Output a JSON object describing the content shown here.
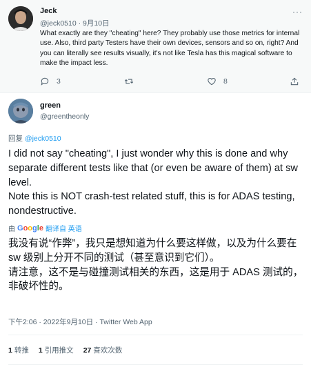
{
  "parent_tweet": {
    "author_name": "Jeck",
    "handle": "@jeck0510",
    "separator": "·",
    "date": "9月10日",
    "more": "···",
    "text": "What exactly are they \"cheating\" here? They probably use those metrics for internal use. Also, third party Testers have their own devices, sensors and so on, right? And you can literally see results visually, it's not like Tesla has this magical software to make the impact less.",
    "reply_count": "3",
    "retweet_count": "",
    "like_count": "8"
  },
  "main_tweet": {
    "author_name": "green",
    "handle": "@greentheonly",
    "reply_prefix": "回复",
    "reply_handle": "@jeck0510",
    "text_en": "I did not say \"cheating\", I just wonder why this is done and why separate different tests like that (or even be aware of them) at sw level.\nNote this is NOT crash-test related stuff, this is for ADAS testing, nondestructive.",
    "translate_prefix": "由",
    "translate_brand": "Google",
    "translate_label": "翻译自 英语",
    "text_zh": "我没有说“作弊”，我只是想知道为什么要这样做，以及为什么要在 sw 级别上分开不同的测试（甚至意识到它们）。\n请注意，这不是与碰撞测试相关的东西，这是用于 ADAS 测试的，非破坏性的。",
    "timestamp": "下午2:06 · 2022年9月10日 · Twitter Web App",
    "stats": {
      "retweets_num": "1",
      "retweets_label": "转推",
      "quotes_num": "1",
      "quotes_label": "引用推文",
      "likes_num": "27",
      "likes_label": "喜欢次数"
    }
  },
  "colors": {
    "accent": "#1d9bf0",
    "secondary_text": "#536471",
    "primary_text": "#0f1419",
    "divider": "#eff3f4"
  },
  "icons": [
    "reply-icon",
    "retweet-icon",
    "like-icon",
    "share-icon",
    "more-icon"
  ]
}
